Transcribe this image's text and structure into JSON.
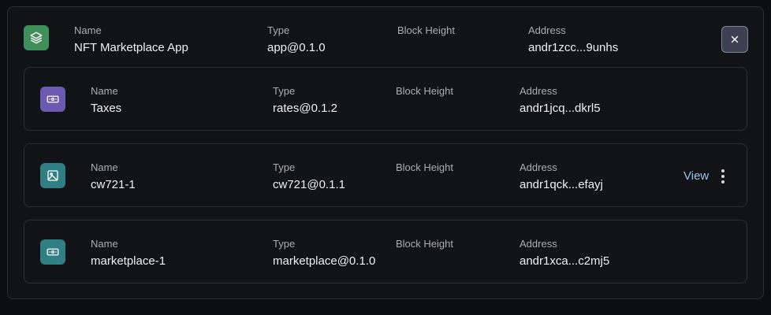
{
  "app": {
    "icon": "layers-icon",
    "icon_color": "#3f8f5a",
    "name_label": "Name",
    "name": "NFT Marketplace App",
    "type_label": "Type",
    "type": "app@0.1.0",
    "block_height_label": "Block Height",
    "address_label": "Address",
    "address": "andr1zcc...9unhs",
    "close_icon": "close-icon"
  },
  "components": [
    {
      "icon": "ticket-icon",
      "icon_color": "#6b5bb0",
      "name_label": "Name",
      "name": "Taxes",
      "type_label": "Type",
      "type": "rates@0.1.2",
      "block_height_label": "Block Height",
      "address_label": "Address",
      "address": "andr1jcq...dkrl5"
    },
    {
      "icon": "image-icon",
      "icon_color": "#2f7f85",
      "name_label": "Name",
      "name": "cw721-1",
      "type_label": "Type",
      "type": "cw721@0.1.1",
      "block_height_label": "Block Height",
      "address_label": "Address",
      "address": "andr1qck...efayj",
      "view_label": "View"
    },
    {
      "icon": "ticket-icon",
      "icon_color": "#2f7f85",
      "name_label": "Name",
      "name": "marketplace-1",
      "type_label": "Type",
      "type": "marketplace@0.1.0",
      "block_height_label": "Block Height",
      "address_label": "Address",
      "address": "andr1xca...c2mj5"
    }
  ],
  "colors": {
    "background": "#0d0e11",
    "panel": "#121317",
    "border": "#2b2e35",
    "link": "#9cc3ee"
  }
}
